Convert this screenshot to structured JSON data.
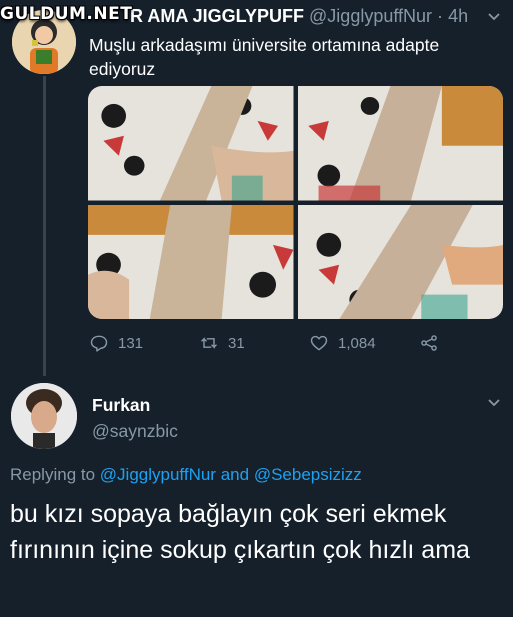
{
  "watermark": "GULDUM.NET",
  "tweet": {
    "display_name": "R AMA JIGGLYPUFF",
    "handle": "@JigglypuffNur",
    "separator": "·",
    "time": "4h",
    "text": "Muşlu arkadaşımı üniversite ortamına adapte ediyoruz",
    "actions": {
      "reply_count": "131",
      "retweet_count": "31",
      "like_count": "1,084"
    }
  },
  "reply": {
    "display_name": "Furkan",
    "handle": "@saynzbic",
    "replying_prefix": "Replying to",
    "replying_user1": "@JigglypuffNur",
    "replying_and": "and",
    "replying_user2": "@Sebepsizizz",
    "text": "bu kızı sopaya bağlayın çok seri ekmek fırınının içine sokup çıkartın çok hızlı ama"
  },
  "icons": {
    "reply": "reply-icon",
    "retweet": "retweet-icon",
    "like": "heart-icon",
    "share": "share-icon",
    "more": "chevron-down-icon"
  },
  "colors": {
    "background": "#15202b",
    "secondary_text": "#8899a6",
    "link": "#1da1f2"
  }
}
